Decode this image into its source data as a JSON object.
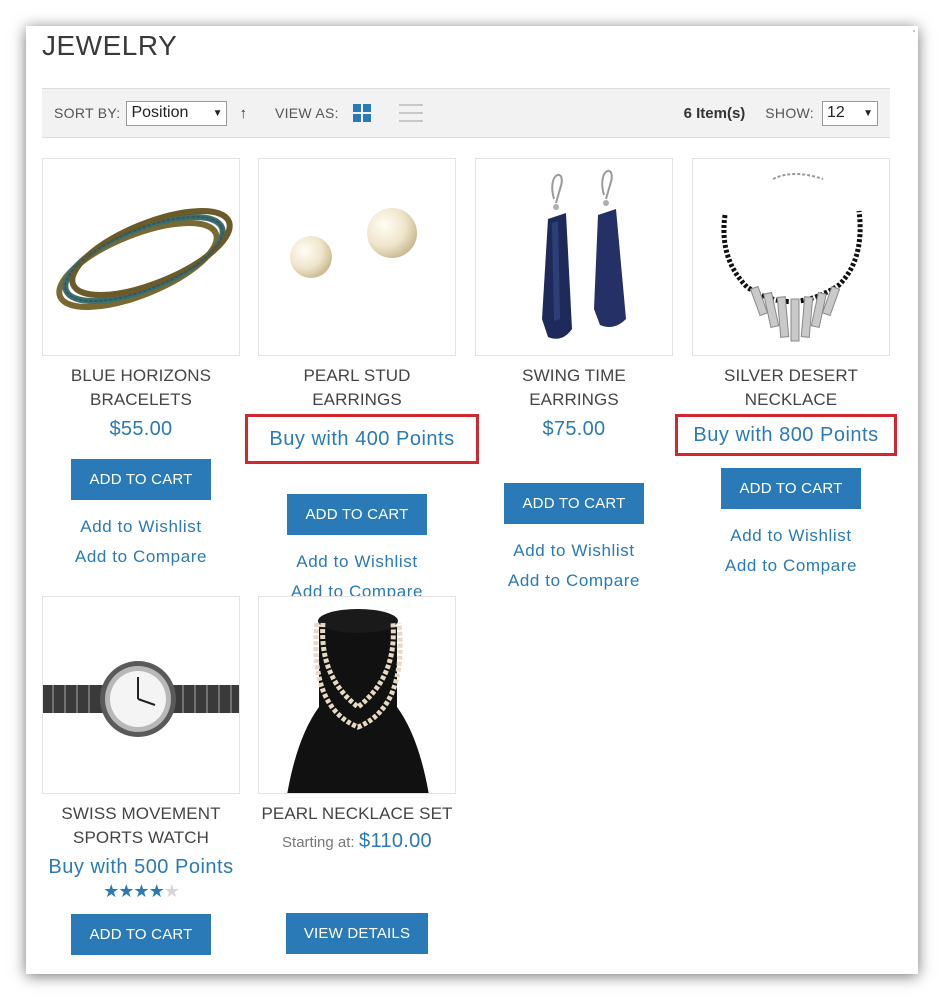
{
  "page": {
    "title": "JEWELRY"
  },
  "toolbar": {
    "sort_label": "SORT BY:",
    "sort_value": "Position",
    "sort_dir_glyph": "↑",
    "view_label": "VIEW AS:",
    "items_count": "6 Item(s)",
    "show_label": "SHOW:",
    "show_value": "12"
  },
  "colors": {
    "accent": "#2a7ab8",
    "highlight": "#d0282e"
  },
  "products": [
    {
      "name": "BLUE HORIZONS BRACELETS",
      "price": "$55.00",
      "button": "ADD TO CART",
      "wishlist": "Add to Wishlist",
      "compare": "Add to Compare",
      "image": "bracelets"
    },
    {
      "name": "PEARL STUD EARRINGS",
      "points": "Buy with 400 Points",
      "button": "ADD TO CART",
      "wishlist": "Add to Wishlist",
      "compare": "Add to Compare",
      "image": "pearl-earrings",
      "highlighted": true
    },
    {
      "name": "SWING TIME EARRINGS",
      "price": "$75.00",
      "button": "ADD TO CART",
      "wishlist": "Add to Wishlist",
      "compare": "Add to Compare",
      "image": "blue-earrings"
    },
    {
      "name": "SILVER DESERT NECKLACE",
      "points": "Buy with 800 Points",
      "button": "ADD TO CART",
      "wishlist": "Add to Wishlist",
      "compare": "Add to Compare",
      "image": "silver-necklace",
      "highlighted": true
    },
    {
      "name": "SWISS MOVEMENT SPORTS WATCH",
      "points": "Buy with 500 Points",
      "rating": 4,
      "rating_max": 5,
      "button": "ADD TO CART",
      "image": "watch"
    },
    {
      "name": "PEARL NECKLACE SET",
      "starting_label": "Starting at:",
      "price": "$110.00",
      "button": "VIEW DETAILS",
      "image": "pearl-necklace"
    }
  ]
}
